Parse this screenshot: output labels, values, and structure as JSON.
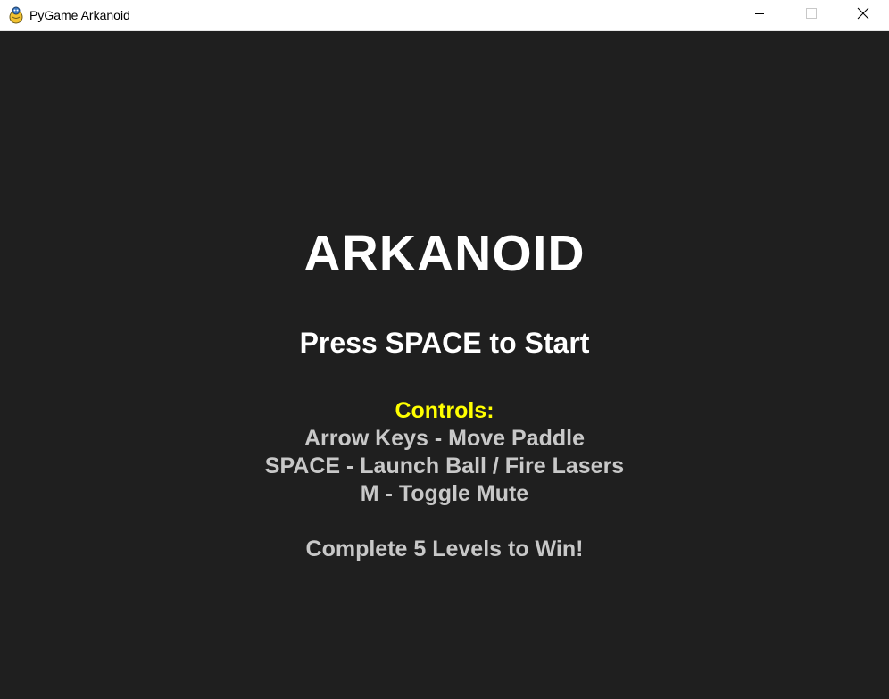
{
  "window": {
    "title": "PyGame Arkanoid",
    "icon": "pygame-snake-icon",
    "controls": [
      "minimize-icon",
      "maximize-icon",
      "close-icon"
    ]
  },
  "game": {
    "background_color": "#1f1f1f",
    "title": "ARKANOID",
    "prompt": "Press SPACE to Start",
    "controls_heading": "Controls:",
    "controls_heading_color": "#ffff00",
    "controls": [
      "Arrow Keys - Move Paddle",
      "SPACE - Launch Ball / Fire Lasers",
      "M - Toggle Mute"
    ],
    "goal": "Complete 5 Levels to Win!"
  }
}
